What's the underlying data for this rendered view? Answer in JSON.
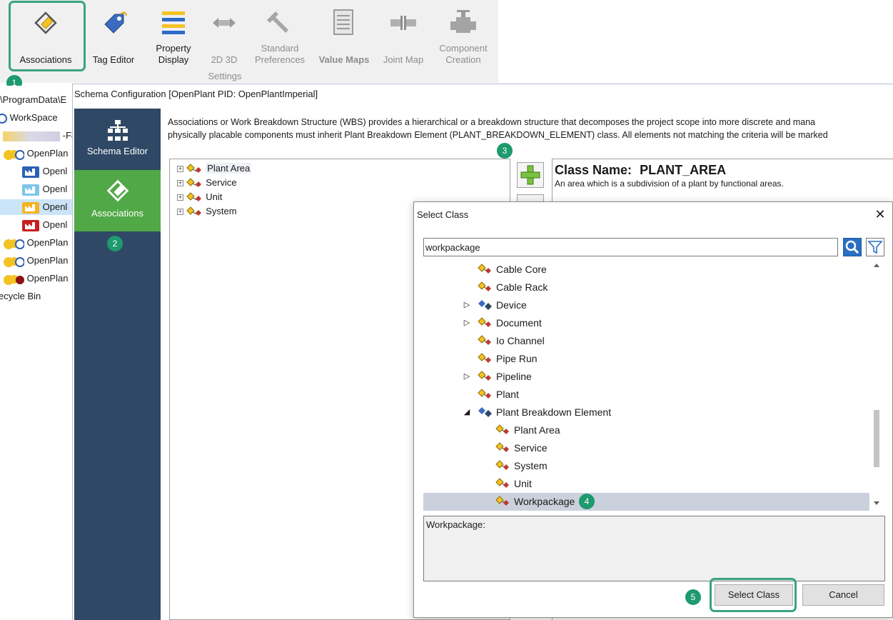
{
  "ribbon": {
    "buttons": [
      {
        "label": "Associations",
        "icon": "associations-icon",
        "enabled": true
      },
      {
        "label": "Tag Editor",
        "icon": "tag-icon",
        "enabled": true
      },
      {
        "label_line1": "Property",
        "label_line2": "Display",
        "icon": "property-display-icon",
        "enabled": true
      },
      {
        "label": "2D 3D",
        "icon": "2d3d-icon",
        "enabled": false
      },
      {
        "label_line1": "Standard",
        "label_line2": "Preferences",
        "icon": "wrench-icon",
        "enabled": false
      },
      {
        "label": "Value Maps",
        "icon": "value-maps-icon",
        "enabled": false
      },
      {
        "label": "Joint Map",
        "icon": "joint-map-icon",
        "enabled": false
      },
      {
        "label_line1": "Component",
        "label_line2": "Creation",
        "icon": "valve-icon",
        "enabled": false
      }
    ],
    "group_label": "Settings"
  },
  "background_tree": {
    "path": "\\ProgramData\\E",
    "items": [
      {
        "label": "WorkSpace",
        "icon": "workspace-icon"
      },
      {
        "label": "-F8",
        "icon": "blurred-icon"
      },
      {
        "label": "OpenPlan",
        "icon": "openplant-icon"
      },
      {
        "label": "Openl",
        "icon": "blue-factory-icon"
      },
      {
        "label": "Openl",
        "icon": "lightblue-factory-icon"
      },
      {
        "label": "Openl",
        "icon": "yellow-factory-icon",
        "selected": true
      },
      {
        "label": "Openl",
        "icon": "red-factory-icon"
      },
      {
        "label": "OpenPlan",
        "icon": "openplant-icon"
      },
      {
        "label": "OpenPlan",
        "icon": "openplant-icon"
      },
      {
        "label": "OpenPlan",
        "icon": "openplant-red-icon"
      },
      {
        "label": "ecycle Bin",
        "icon": "recycle-icon"
      }
    ]
  },
  "schema_window": {
    "title": "Schema Configuration [OpenPlant PID: OpenPlantImperial]",
    "nav": [
      {
        "label": "Schema Editor",
        "icon": "schema-editor-icon",
        "active": false
      },
      {
        "label": "Associations",
        "icon": "associations-icon",
        "active": true
      }
    ],
    "description_line1": "Associations or Work Breakdown Structure (WBS) provides a hierarchical or a breakdown structure that decomposes the project scope into more discrete and mana",
    "description_line2": "physically placable components must inherit Plant Breakdown Element (PLANT_BREAKDOWN_ELEMENT) class. All elements not matching the criteria will be marked",
    "tree": [
      "Plant Area",
      "Service",
      "Unit",
      "System"
    ],
    "class_name_label": "Class Name:",
    "class_name_value": "PLANT_AREA",
    "class_description": "An area which is a subdivision of a plant by functional areas."
  },
  "dialog": {
    "title": "Select Class",
    "search_value": "workpackage",
    "items": [
      {
        "label": "Cable Core",
        "level": 1,
        "expander": "",
        "icon": "class-icon"
      },
      {
        "label": "Cable Rack",
        "level": 1,
        "expander": "",
        "icon": "class-icon"
      },
      {
        "label": "Device",
        "level": 1,
        "expander": "collapsed",
        "icon": "abstract-class-icon"
      },
      {
        "label": "Document",
        "level": 1,
        "expander": "collapsed",
        "icon": "class-icon"
      },
      {
        "label": "Io Channel",
        "level": 1,
        "expander": "",
        "icon": "class-icon"
      },
      {
        "label": "Pipe Run",
        "level": 1,
        "expander": "",
        "icon": "class-icon"
      },
      {
        "label": "Pipeline",
        "level": 1,
        "expander": "collapsed",
        "icon": "class-icon"
      },
      {
        "label": "Plant",
        "level": 1,
        "expander": "",
        "icon": "class-icon"
      },
      {
        "label": "Plant Breakdown Element",
        "level": 1,
        "expander": "expanded",
        "icon": "abstract-class-icon"
      },
      {
        "label": "Plant Area",
        "level": 2,
        "expander": "",
        "icon": "class-icon"
      },
      {
        "label": "Service",
        "level": 2,
        "expander": "",
        "icon": "class-icon"
      },
      {
        "label": "System",
        "level": 2,
        "expander": "",
        "icon": "class-icon"
      },
      {
        "label": "Unit",
        "level": 2,
        "expander": "",
        "icon": "class-icon"
      },
      {
        "label": "Workpackage",
        "level": 2,
        "expander": "",
        "icon": "class-icon",
        "selected": true
      }
    ],
    "info_text": "Workpackage:",
    "select_button": "Select Class",
    "cancel_button": "Cancel"
  },
  "callouts": [
    "1",
    "2",
    "3",
    "4",
    "5"
  ],
  "colors": {
    "accent_green": "#1e9a6e",
    "highlight_border": "#3aa37c",
    "nav_bg": "#2f4865",
    "nav_active": "#51a846",
    "selection": "#cbd1dc"
  }
}
